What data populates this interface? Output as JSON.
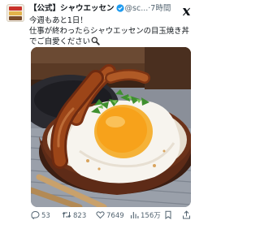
{
  "post": {
    "author_name": "【公式】シャウエッセン",
    "handle": "@sc...",
    "separator": "·",
    "time": "7時間",
    "text_lines": [
      "今週もあと1日！",
      "仕事が終わったらシャウエッセンの目玉焼き丼",
      "でご自愛ください"
    ]
  },
  "actions": {
    "replies": "53",
    "reposts": "823",
    "likes": "7649",
    "views": "156万"
  },
  "colors": {
    "verified_badge": "#1d9bf0",
    "secondary_text": "#536471",
    "primary_text": "#0f1419"
  },
  "icons": [
    "verified-badge-icon",
    "x-logo-icon",
    "magnifier-emoji-icon",
    "reply-icon",
    "repost-icon",
    "like-icon",
    "views-icon",
    "bookmark-icon",
    "share-icon"
  ]
}
